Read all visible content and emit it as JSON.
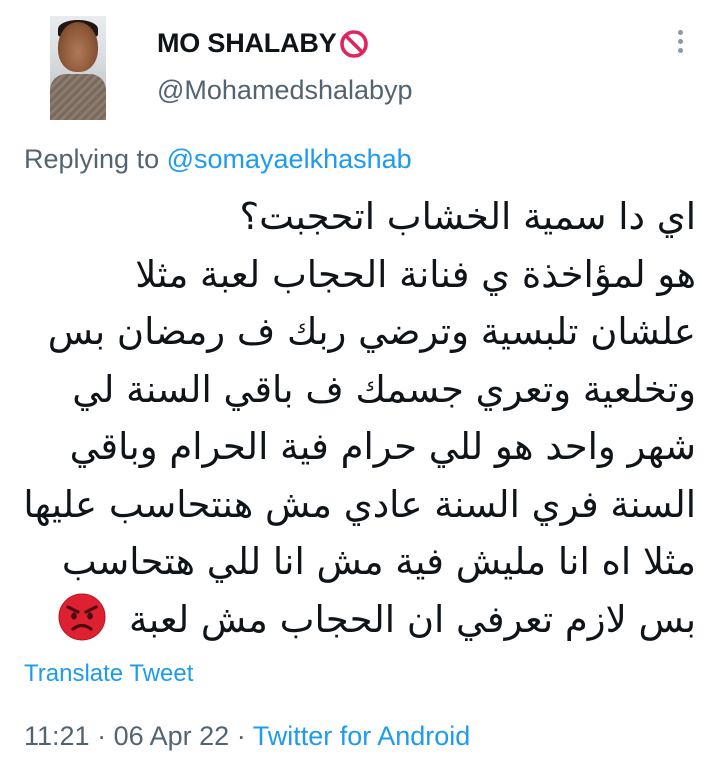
{
  "author": {
    "display_name": "MO SHALABY",
    "name_badge_icon": "no-entry-icon",
    "handle": "@Mohamedshalabyp"
  },
  "reply": {
    "prefix": "Replying to",
    "to_handle": "@somayaelkhashab"
  },
  "tweet": {
    "lines": [
      "اي دا سمية الخشاب اتحجبت؟",
      "هو لمؤاخذة ي فنانة الحجاب لعبة مثلا",
      "علشان تلبسية وترضي ربك ف رمضان بس",
      "وتخلعية وتعري جسمك ف باقي السنة لي",
      "شهر واحد هو للي حرام فية الحرام وباقي",
      "السنة فري السنة عادي مش هنتحاسب عليها",
      "مثلا اه انا مليش فية مش انا للي هتحاسب",
      "بس لازم تعرفي ان الحجاب مش لعبة"
    ],
    "end_emoji": "angry-face-icon"
  },
  "actions": {
    "translate_label": "Translate Tweet"
  },
  "meta": {
    "time": "11:21",
    "separator": "·",
    "date": "06 Apr 22",
    "source": "Twitter for Android"
  },
  "colors": {
    "accent": "#1d9bf0",
    "secondary_text": "#536471",
    "primary_text": "#0f1419",
    "badge_red": "#e0245e"
  }
}
